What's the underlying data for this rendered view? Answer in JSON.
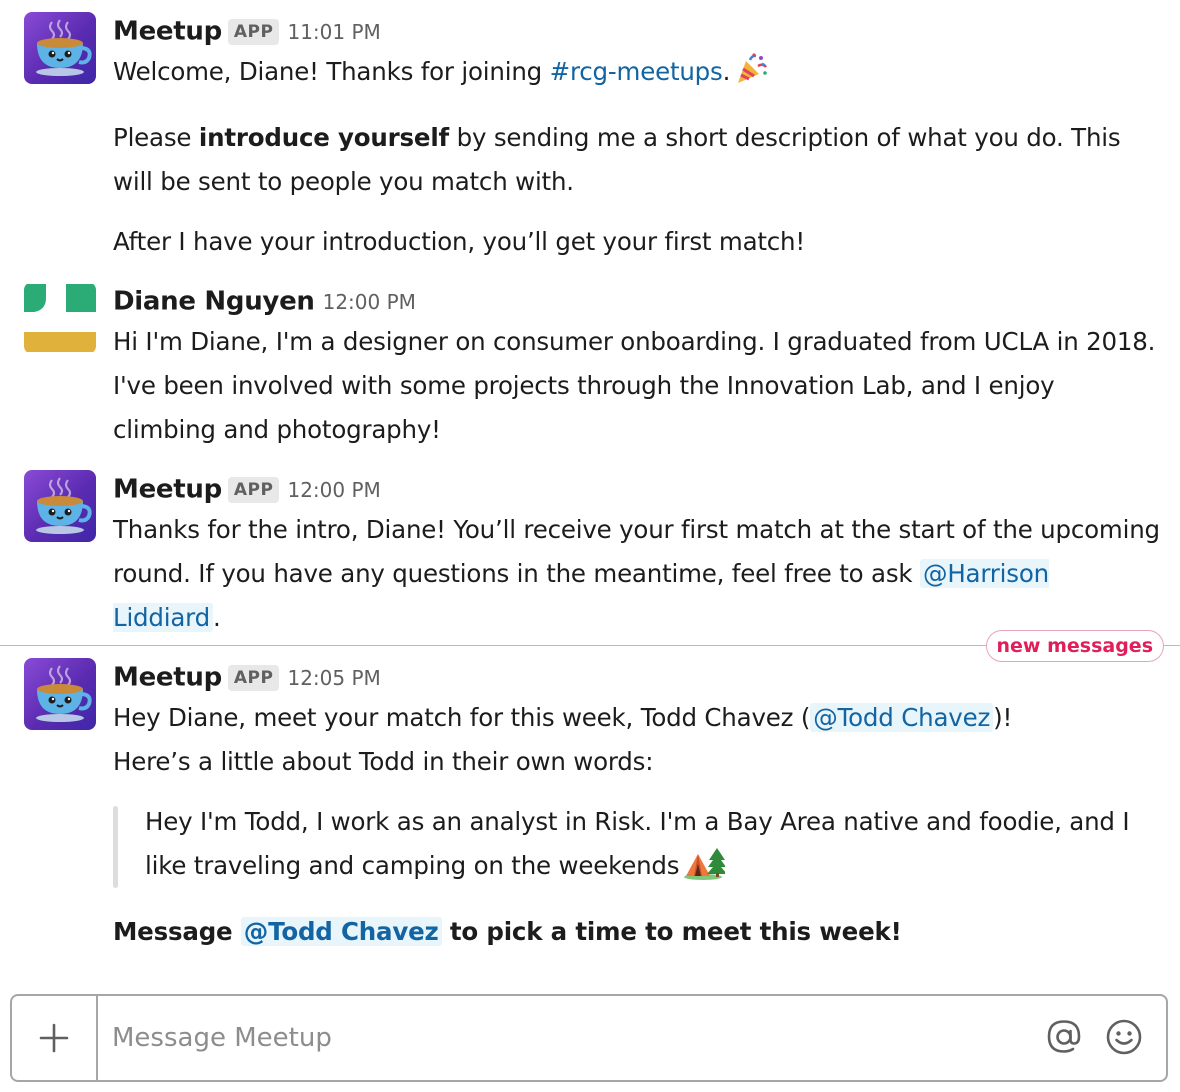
{
  "messages": [
    {
      "sender": "Meetup",
      "badge": "APP",
      "time": "11:01 PM",
      "line1_pre": "Welcome, Diane! Thanks for joining ",
      "channel": "#rcg-meetups",
      "line1_post": ".",
      "p2_pre": "Please ",
      "p2_bold": "introduce yourself",
      "p2_post": " by sending me a short description of what you do. This will be sent to people you match with.",
      "p3": "After I have your introduction, you’ll get your first match!"
    },
    {
      "sender": "Diane Nguyen",
      "time": "12:00 PM",
      "text": "Hi I'm Diane, I'm a designer on consumer onboarding. I graduated from UCLA in 2018. I've been involved with some projects through the Innovation Lab, and I enjoy climbing and photography!"
    },
    {
      "sender": "Meetup",
      "badge": "APP",
      "time": "12:00 PM",
      "text_pre": "Thanks for the intro, Diane! You’ll receive your first match at the start of the upcoming round. If you have any questions in the meantime, feel free to ask ",
      "mention": "@Harrison Liddiard",
      "text_post": "."
    },
    {
      "sender": "Meetup",
      "badge": "APP",
      "time": "12:05 PM",
      "line1_pre": "Hey Diane, meet your match for this week, Todd Chavez (",
      "mention1": "@Todd Chavez",
      "line1_post": ")!",
      "line2": "Here’s a little about Todd in their own words:",
      "quote": "Hey I'm Todd, I work as an analyst in Risk. I'm a Bay Area native and foodie, and I like traveling and camping on the weekends",
      "cta_pre": "Message ",
      "mention2": "@Todd Chavez",
      "cta_post": " to pick a time to meet this week!"
    }
  ],
  "divider": {
    "label": "new messages"
  },
  "composer": {
    "placeholder": "Message Meetup"
  },
  "icons": {
    "bot_avatar": "teacup-icon",
    "user_avatar": "green-yellow-avatar",
    "party": "party-popper-icon",
    "camping": "tent-tree-icon",
    "plus": "plus-icon",
    "at": "at-icon",
    "emoji": "smiley-icon"
  },
  "colors": {
    "link": "#1264a3",
    "mention_bg": "#e8f5fa",
    "new_messages": "#e01e5a",
    "bot_avatar": "#6a35c4",
    "user_green": "#2bac76",
    "user_yellow": "#e0b23c"
  }
}
